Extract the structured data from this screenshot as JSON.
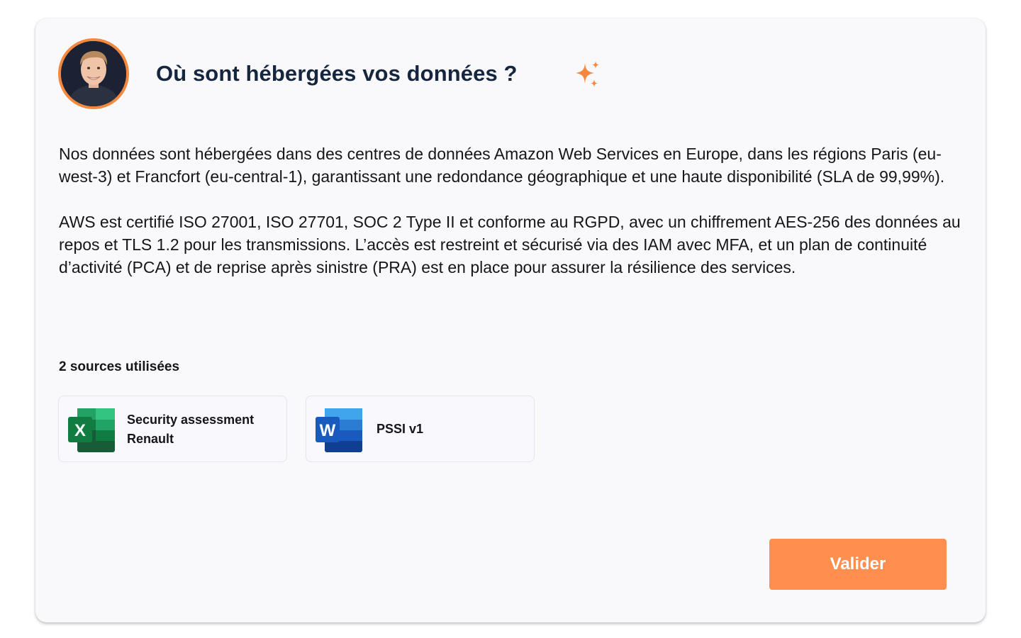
{
  "question": {
    "title": "Où sont hébergées vos données ?",
    "avatar_icon": "user-avatar-photo",
    "sparkle_icon": "ai-sparkle-icon",
    "accent_color": "#f5883f"
  },
  "answer": {
    "paragraphs": [
      "Nos données sont hébergées dans des centres de données Amazon Web Services en Europe, dans les régions Paris (eu-west-3) et Francfort (eu-central-1), garantissant une redondance géographique et une haute disponibilité (SLA de 99,99%).",
      "AWS est certifié ISO 27001, ISO 27701, SOC 2 Type II et conforme au RGPD, avec un chiffrement AES-256 des données au repos et TLS 1.2 pour les transmissions. L’accès est restreint et sécurisé via des IAM avec MFA, et un plan de continuité d’activité (PCA) et de reprise après sinistre (PRA) est en place pour assurer la résilience des services."
    ]
  },
  "sources": {
    "title": "2 sources utilisées",
    "items": [
      {
        "label": "Security assessment Renault",
        "icon": "excel-icon",
        "icon_letter": "X",
        "color": "#1d6f42"
      },
      {
        "label": "PSSI v1",
        "icon": "word-icon",
        "icon_letter": "W",
        "color": "#185abd"
      }
    ]
  },
  "actions": {
    "validate_label": "Valider",
    "validate_color": "#ff8e4f"
  }
}
